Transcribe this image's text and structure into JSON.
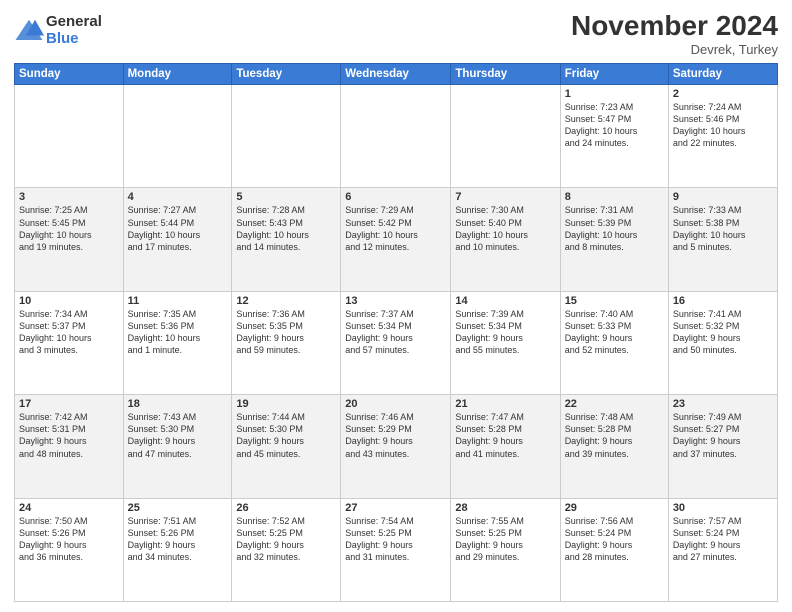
{
  "header": {
    "logo_general": "General",
    "logo_blue": "Blue",
    "month_title": "November 2024",
    "location": "Devrek, Turkey"
  },
  "weekdays": [
    "Sunday",
    "Monday",
    "Tuesday",
    "Wednesday",
    "Thursday",
    "Friday",
    "Saturday"
  ],
  "weeks": [
    [
      {
        "day": "",
        "info": ""
      },
      {
        "day": "",
        "info": ""
      },
      {
        "day": "",
        "info": ""
      },
      {
        "day": "",
        "info": ""
      },
      {
        "day": "",
        "info": ""
      },
      {
        "day": "1",
        "info": "Sunrise: 7:23 AM\nSunset: 5:47 PM\nDaylight: 10 hours\nand 24 minutes."
      },
      {
        "day": "2",
        "info": "Sunrise: 7:24 AM\nSunset: 5:46 PM\nDaylight: 10 hours\nand 22 minutes."
      }
    ],
    [
      {
        "day": "3",
        "info": "Sunrise: 7:25 AM\nSunset: 5:45 PM\nDaylight: 10 hours\nand 19 minutes."
      },
      {
        "day": "4",
        "info": "Sunrise: 7:27 AM\nSunset: 5:44 PM\nDaylight: 10 hours\nand 17 minutes."
      },
      {
        "day": "5",
        "info": "Sunrise: 7:28 AM\nSunset: 5:43 PM\nDaylight: 10 hours\nand 14 minutes."
      },
      {
        "day": "6",
        "info": "Sunrise: 7:29 AM\nSunset: 5:42 PM\nDaylight: 10 hours\nand 12 minutes."
      },
      {
        "day": "7",
        "info": "Sunrise: 7:30 AM\nSunset: 5:40 PM\nDaylight: 10 hours\nand 10 minutes."
      },
      {
        "day": "8",
        "info": "Sunrise: 7:31 AM\nSunset: 5:39 PM\nDaylight: 10 hours\nand 8 minutes."
      },
      {
        "day": "9",
        "info": "Sunrise: 7:33 AM\nSunset: 5:38 PM\nDaylight: 10 hours\nand 5 minutes."
      }
    ],
    [
      {
        "day": "10",
        "info": "Sunrise: 7:34 AM\nSunset: 5:37 PM\nDaylight: 10 hours\nand 3 minutes."
      },
      {
        "day": "11",
        "info": "Sunrise: 7:35 AM\nSunset: 5:36 PM\nDaylight: 10 hours\nand 1 minute."
      },
      {
        "day": "12",
        "info": "Sunrise: 7:36 AM\nSunset: 5:35 PM\nDaylight: 9 hours\nand 59 minutes."
      },
      {
        "day": "13",
        "info": "Sunrise: 7:37 AM\nSunset: 5:34 PM\nDaylight: 9 hours\nand 57 minutes."
      },
      {
        "day": "14",
        "info": "Sunrise: 7:39 AM\nSunset: 5:34 PM\nDaylight: 9 hours\nand 55 minutes."
      },
      {
        "day": "15",
        "info": "Sunrise: 7:40 AM\nSunset: 5:33 PM\nDaylight: 9 hours\nand 52 minutes."
      },
      {
        "day": "16",
        "info": "Sunrise: 7:41 AM\nSunset: 5:32 PM\nDaylight: 9 hours\nand 50 minutes."
      }
    ],
    [
      {
        "day": "17",
        "info": "Sunrise: 7:42 AM\nSunset: 5:31 PM\nDaylight: 9 hours\nand 48 minutes."
      },
      {
        "day": "18",
        "info": "Sunrise: 7:43 AM\nSunset: 5:30 PM\nDaylight: 9 hours\nand 47 minutes."
      },
      {
        "day": "19",
        "info": "Sunrise: 7:44 AM\nSunset: 5:30 PM\nDaylight: 9 hours\nand 45 minutes."
      },
      {
        "day": "20",
        "info": "Sunrise: 7:46 AM\nSunset: 5:29 PM\nDaylight: 9 hours\nand 43 minutes."
      },
      {
        "day": "21",
        "info": "Sunrise: 7:47 AM\nSunset: 5:28 PM\nDaylight: 9 hours\nand 41 minutes."
      },
      {
        "day": "22",
        "info": "Sunrise: 7:48 AM\nSunset: 5:28 PM\nDaylight: 9 hours\nand 39 minutes."
      },
      {
        "day": "23",
        "info": "Sunrise: 7:49 AM\nSunset: 5:27 PM\nDaylight: 9 hours\nand 37 minutes."
      }
    ],
    [
      {
        "day": "24",
        "info": "Sunrise: 7:50 AM\nSunset: 5:26 PM\nDaylight: 9 hours\nand 36 minutes."
      },
      {
        "day": "25",
        "info": "Sunrise: 7:51 AM\nSunset: 5:26 PM\nDaylight: 9 hours\nand 34 minutes."
      },
      {
        "day": "26",
        "info": "Sunrise: 7:52 AM\nSunset: 5:25 PM\nDaylight: 9 hours\nand 32 minutes."
      },
      {
        "day": "27",
        "info": "Sunrise: 7:54 AM\nSunset: 5:25 PM\nDaylight: 9 hours\nand 31 minutes."
      },
      {
        "day": "28",
        "info": "Sunrise: 7:55 AM\nSunset: 5:25 PM\nDaylight: 9 hours\nand 29 minutes."
      },
      {
        "day": "29",
        "info": "Sunrise: 7:56 AM\nSunset: 5:24 PM\nDaylight: 9 hours\nand 28 minutes."
      },
      {
        "day": "30",
        "info": "Sunrise: 7:57 AM\nSunset: 5:24 PM\nDaylight: 9 hours\nand 27 minutes."
      }
    ]
  ]
}
